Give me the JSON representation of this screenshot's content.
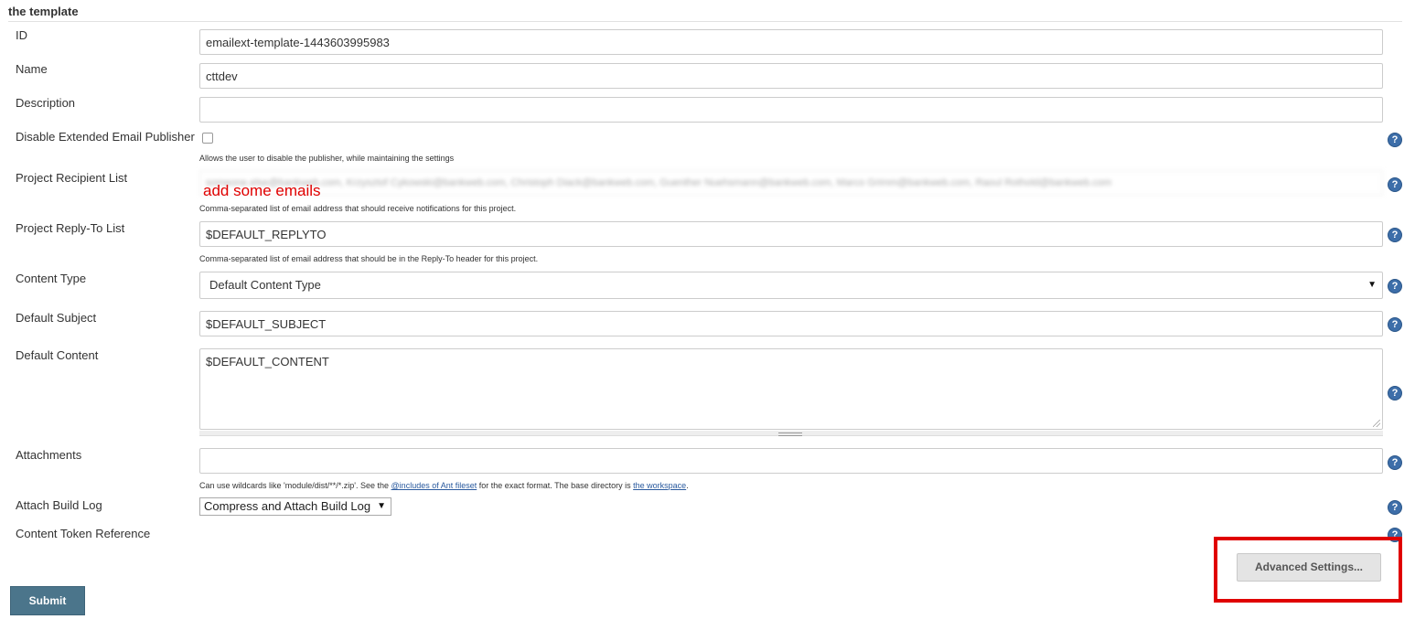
{
  "section": {
    "title": "the template"
  },
  "fields": {
    "id": {
      "label": "ID",
      "value": "emailext-template-1443603995983"
    },
    "name": {
      "label": "Name",
      "value": "cttdev"
    },
    "description": {
      "label": "Description",
      "value": ""
    },
    "disable_publisher": {
      "label": "Disable Extended Email Publisher",
      "checked": false,
      "hint": "Allows the user to disable the publisher, while maintaining the settings"
    },
    "recipient_list": {
      "label": "Project Recipient List",
      "value": "someone.else@bankweb.com, Krzysztof Cykowski@bankweb.com, Christoph Diack@bankweb.com, Guenther Nuehsmann@bankweb.com, Marco Grimm@bankweb.com, Raoul Rothold@bankweb.com",
      "annotation": "add some emails",
      "hint": "Comma-separated list of email address that should receive notifications for this project."
    },
    "reply_to": {
      "label": "Project Reply-To List",
      "value": "$DEFAULT_REPLYTO",
      "hint": "Comma-separated list of email address that should be in the Reply-To header for this project."
    },
    "content_type": {
      "label": "Content Type",
      "value": "Default Content Type"
    },
    "default_subject": {
      "label": "Default Subject",
      "value": "$DEFAULT_SUBJECT"
    },
    "default_content": {
      "label": "Default Content",
      "value": "$DEFAULT_CONTENT"
    },
    "attachments": {
      "label": "Attachments",
      "value": "",
      "hint_prefix": "Can use wildcards like 'module/dist/**/*.zip'. See the ",
      "hint_link1": "@includes of Ant fileset",
      "hint_middle": " for the exact format. The base directory is ",
      "hint_link2": "the workspace",
      "hint_suffix": "."
    },
    "attach_build_log": {
      "label": "Attach Build Log",
      "value": "Compress and Attach Build Log"
    },
    "content_token_reference": {
      "label": "Content Token Reference"
    }
  },
  "buttons": {
    "advanced": "Advanced Settings...",
    "submit": "Submit"
  },
  "icons": {
    "help": "help-icon",
    "dropdown": "chevron-down-icon"
  },
  "colors": {
    "annotation": "#e00000",
    "submit_bg": "#4b758b",
    "help_bg": "#3d6ea9"
  }
}
